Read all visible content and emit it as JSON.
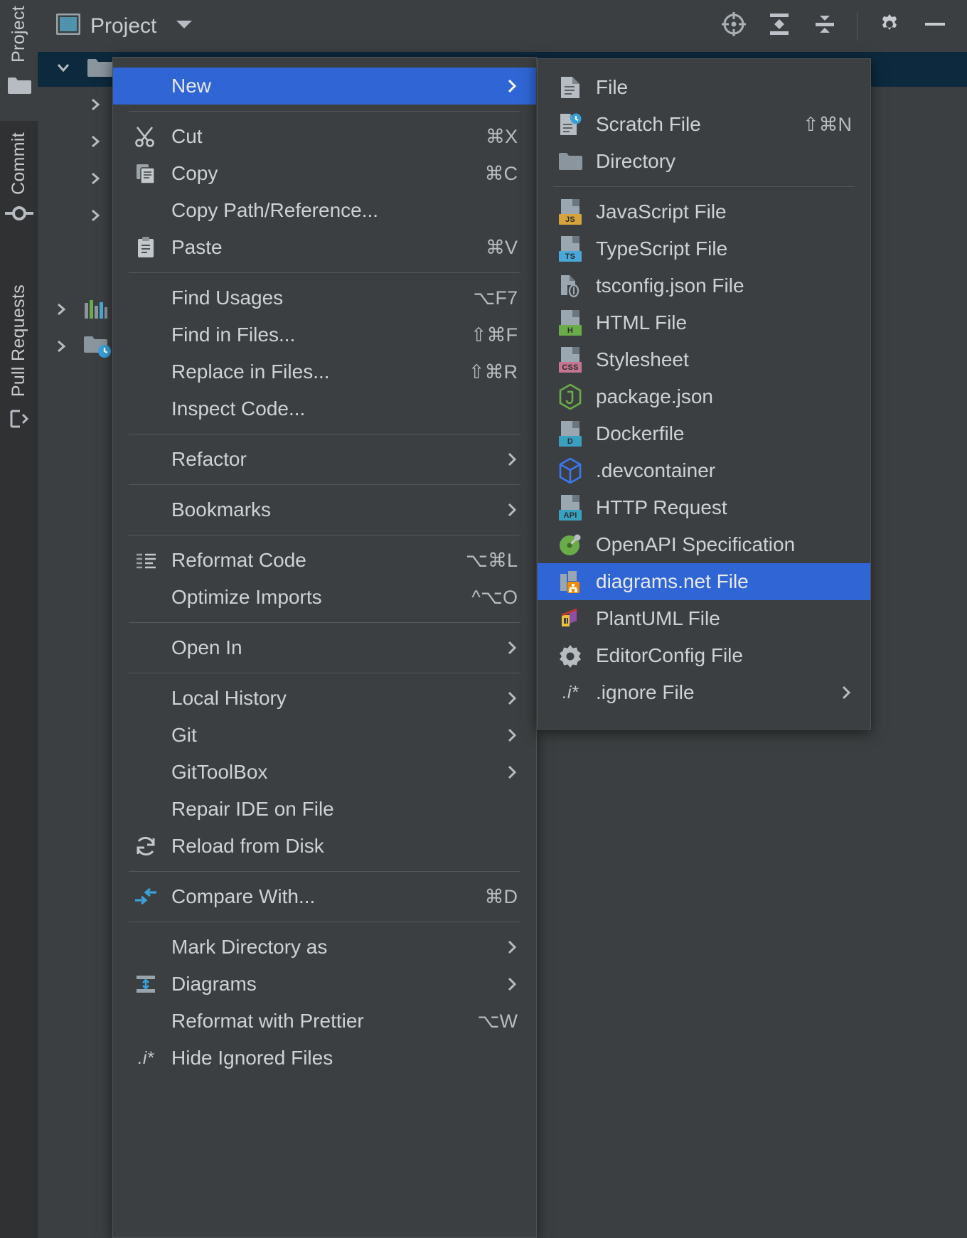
{
  "app": {
    "tool_window_title": "Project",
    "accent_blue": "#2f65d4",
    "menu_bg": "#3c3f41",
    "selection_bg": "#0d293e"
  },
  "stripe": {
    "items": [
      {
        "label": "Project",
        "icon": "folder-icon",
        "selected": true
      },
      {
        "label": "Commit",
        "icon": "commit-icon",
        "selected": false
      },
      {
        "label": "Pull Requests",
        "icon": "pull-request-icon",
        "selected": false
      }
    ]
  },
  "toolbar": {
    "actions": [
      {
        "name": "select-opened-file-icon",
        "label": "Select Opened File"
      },
      {
        "name": "expand-all-icon",
        "label": "Expand All"
      },
      {
        "name": "collapse-all-icon",
        "label": "Collapse All"
      },
      {
        "name": "settings-gear-icon",
        "label": "Options"
      },
      {
        "name": "hide-icon",
        "label": "Hide"
      }
    ]
  },
  "tree": {
    "rows": [
      {
        "expanded": true,
        "selected": true,
        "icon": "folder-icon"
      },
      {
        "expanded": false,
        "selected": false,
        "icon": "none"
      },
      {
        "expanded": false,
        "selected": false,
        "icon": "none"
      },
      {
        "expanded": false,
        "selected": false,
        "icon": "none"
      },
      {
        "expanded": false,
        "selected": false,
        "icon": "none"
      },
      {
        "expanded": false,
        "selected": false,
        "icon": "none"
      },
      {
        "expanded": false,
        "selected": false,
        "icon": "chart-icon"
      },
      {
        "expanded": false,
        "selected": false,
        "icon": "history-folder-icon"
      }
    ]
  },
  "context_menu": {
    "items": [
      {
        "kind": "item",
        "label": "New",
        "shortcut": "",
        "icon": "none",
        "submenu": true,
        "highlight": true
      },
      {
        "kind": "separator"
      },
      {
        "kind": "item",
        "label": "Cut",
        "shortcut": "⌘X",
        "icon": "scissors-icon",
        "submenu": false
      },
      {
        "kind": "item",
        "label": "Copy",
        "shortcut": "⌘C",
        "icon": "copy-icon",
        "submenu": false
      },
      {
        "kind": "item",
        "label": "Copy Path/Reference...",
        "shortcut": "",
        "icon": "none",
        "submenu": false
      },
      {
        "kind": "item",
        "label": "Paste",
        "shortcut": "⌘V",
        "icon": "paste-icon",
        "submenu": false
      },
      {
        "kind": "separator"
      },
      {
        "kind": "item",
        "label": "Find Usages",
        "shortcut": "⌥F7",
        "icon": "none",
        "submenu": false
      },
      {
        "kind": "item",
        "label": "Find in Files...",
        "shortcut": "⇧⌘F",
        "icon": "none",
        "submenu": false
      },
      {
        "kind": "item",
        "label": "Replace in Files...",
        "shortcut": "⇧⌘R",
        "icon": "none",
        "submenu": false
      },
      {
        "kind": "item",
        "label": "Inspect Code...",
        "shortcut": "",
        "icon": "none",
        "submenu": false
      },
      {
        "kind": "separator"
      },
      {
        "kind": "item",
        "label": "Refactor",
        "shortcut": "",
        "icon": "none",
        "submenu": true
      },
      {
        "kind": "separator"
      },
      {
        "kind": "item",
        "label": "Bookmarks",
        "shortcut": "",
        "icon": "none",
        "submenu": true
      },
      {
        "kind": "separator"
      },
      {
        "kind": "item",
        "label": "Reformat Code",
        "shortcut": "⌥⌘L",
        "icon": "reformat-icon",
        "submenu": false
      },
      {
        "kind": "item",
        "label": "Optimize Imports",
        "shortcut": "^⌥O",
        "icon": "none",
        "submenu": false
      },
      {
        "kind": "separator"
      },
      {
        "kind": "item",
        "label": "Open In",
        "shortcut": "",
        "icon": "none",
        "submenu": true
      },
      {
        "kind": "separator"
      },
      {
        "kind": "item",
        "label": "Local History",
        "shortcut": "",
        "icon": "none",
        "submenu": true
      },
      {
        "kind": "item",
        "label": "Git",
        "shortcut": "",
        "icon": "none",
        "submenu": true
      },
      {
        "kind": "item",
        "label": "GitToolBox",
        "shortcut": "",
        "icon": "none",
        "submenu": true
      },
      {
        "kind": "item",
        "label": "Repair IDE on File",
        "shortcut": "",
        "icon": "none",
        "submenu": false
      },
      {
        "kind": "item",
        "label": "Reload from Disk",
        "shortcut": "",
        "icon": "reload-icon",
        "submenu": false
      },
      {
        "kind": "separator"
      },
      {
        "kind": "item",
        "label": "Compare With...",
        "shortcut": "⌘D",
        "icon": "compare-icon",
        "submenu": false
      },
      {
        "kind": "separator"
      },
      {
        "kind": "item",
        "label": "Mark Directory as",
        "shortcut": "",
        "icon": "none",
        "submenu": true
      },
      {
        "kind": "item",
        "label": "Diagrams",
        "shortcut": "",
        "icon": "diagrams-icon",
        "submenu": true
      },
      {
        "kind": "item",
        "label": "Reformat with Prettier",
        "shortcut": "⌥W",
        "icon": "none",
        "submenu": false
      },
      {
        "kind": "item",
        "label": "Hide Ignored Files",
        "shortcut": "",
        "icon": "ignore-icon",
        "submenu": false
      }
    ]
  },
  "new_submenu": {
    "items": [
      {
        "kind": "item",
        "label": "File",
        "shortcut": "",
        "icon": "file-icon",
        "submenu": false
      },
      {
        "kind": "item",
        "label": "Scratch File",
        "shortcut": "⇧⌘N",
        "icon": "scratch-file-icon",
        "submenu": false
      },
      {
        "kind": "item",
        "label": "Directory",
        "shortcut": "",
        "icon": "directory-icon",
        "submenu": false
      },
      {
        "kind": "separator"
      },
      {
        "kind": "item",
        "label": "JavaScript File",
        "shortcut": "",
        "icon": "javascript-file-icon",
        "tag": "JS",
        "tag_bg": "#d8a33a",
        "submenu": false
      },
      {
        "kind": "item",
        "label": "TypeScript File",
        "shortcut": "",
        "icon": "typescript-file-icon",
        "tag": "TS",
        "tag_bg": "#4aa8d8",
        "submenu": false
      },
      {
        "kind": "item",
        "label": "tsconfig.json File",
        "shortcut": "",
        "icon": "tsconfig-file-icon",
        "submenu": false
      },
      {
        "kind": "item",
        "label": "HTML File",
        "shortcut": "",
        "icon": "html-file-icon",
        "tag": "H",
        "tag_bg": "#6aab4a",
        "submenu": false
      },
      {
        "kind": "item",
        "label": "Stylesheet",
        "shortcut": "",
        "icon": "stylesheet-file-icon",
        "tag": "CSS",
        "tag_bg": "#c57590",
        "submenu": false
      },
      {
        "kind": "item",
        "label": "package.json",
        "shortcut": "",
        "icon": "nodejs-icon",
        "submenu": false
      },
      {
        "kind": "item",
        "label": "Dockerfile",
        "shortcut": "",
        "icon": "dockerfile-icon",
        "tag": "D",
        "tag_bg": "#3aa0c0",
        "submenu": false
      },
      {
        "kind": "item",
        "label": ".devcontainer",
        "shortcut": "",
        "icon": "devcontainer-cube-icon",
        "submenu": false
      },
      {
        "kind": "item",
        "label": "HTTP Request",
        "shortcut": "",
        "icon": "http-request-icon",
        "tag": "API",
        "tag_bg": "#3aa0c0",
        "submenu": false
      },
      {
        "kind": "item",
        "label": "OpenAPI Specification",
        "shortcut": "",
        "icon": "openapi-icon",
        "submenu": false
      },
      {
        "kind": "item",
        "label": "diagrams.net File",
        "shortcut": "",
        "icon": "diagramsnet-file-icon",
        "submenu": false,
        "highlight": true
      },
      {
        "kind": "item",
        "label": "PlantUML File",
        "shortcut": "",
        "icon": "plantuml-icon",
        "submenu": false
      },
      {
        "kind": "item",
        "label": "EditorConfig File",
        "shortcut": "",
        "icon": "editorconfig-gear-icon",
        "submenu": false
      },
      {
        "kind": "item",
        "label": ".ignore File",
        "shortcut": "",
        "icon": "ignore-icon",
        "submenu": true
      }
    ]
  }
}
